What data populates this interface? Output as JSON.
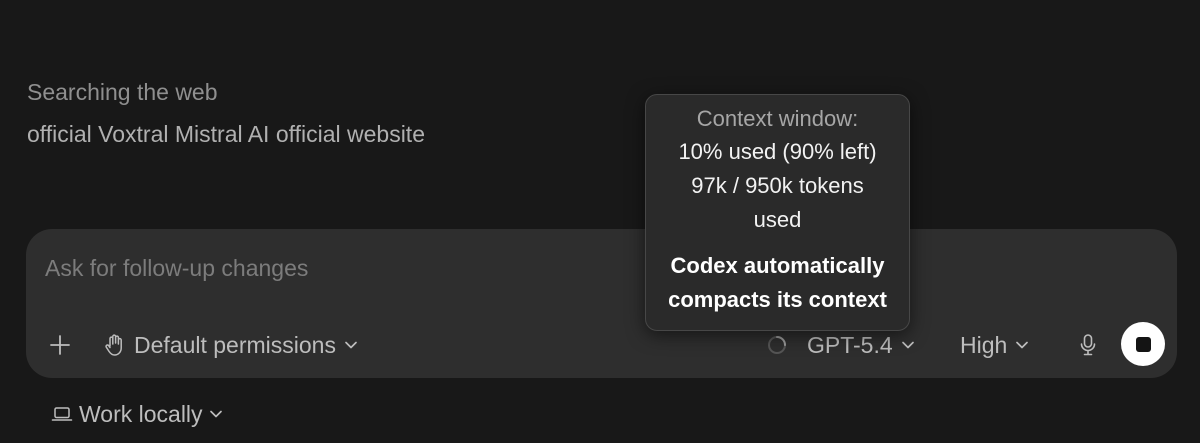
{
  "activity": {
    "title": "Searching the web",
    "query": "official Voxtral Mistral AI official website"
  },
  "composer": {
    "placeholder": "Ask for follow-up changes",
    "add_icon": "plus-icon",
    "permissions": {
      "icon": "hand-icon",
      "label": "Default permissions"
    },
    "model": {
      "status_icon": "spinner-icon",
      "label": "GPT-5.4"
    },
    "effort": {
      "label": "High"
    },
    "mic_icon": "microphone-icon",
    "stop_icon": "stop-icon"
  },
  "footer": {
    "work_mode": {
      "icon": "laptop-icon",
      "label": "Work locally"
    }
  },
  "tooltip": {
    "heading": "Context window:",
    "usage": "10% used (90% left)",
    "tokens": "97k / 950k tokens used",
    "note": "Codex automatically compacts its context"
  },
  "colors": {
    "background": "#181818",
    "composer": "#2e2e2e",
    "tooltip": "#2a2a2a",
    "stop_button": "#ffffff"
  }
}
